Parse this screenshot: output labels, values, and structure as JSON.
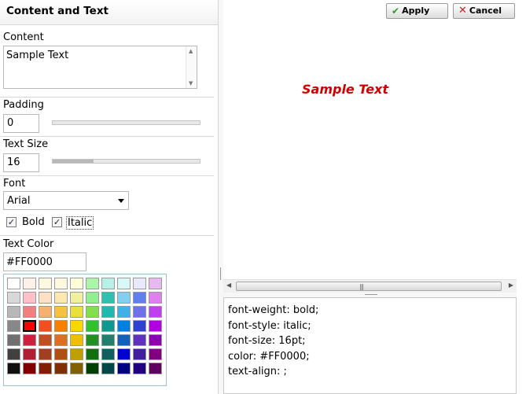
{
  "panel": {
    "title": "Content and Text"
  },
  "content": {
    "label": "Content",
    "value": "Sample Text"
  },
  "padding": {
    "label": "Padding",
    "value": "0",
    "slider_fraction": 0.0
  },
  "text_size": {
    "label": "Text Size",
    "value": "16",
    "slider_fraction": 0.28
  },
  "font": {
    "label": "Font",
    "selected": "Arial"
  },
  "bold": {
    "label": "Bold",
    "checked": true
  },
  "italic": {
    "label": "Italic",
    "checked": true
  },
  "text_color": {
    "label": "Text Color",
    "value": "#FF0000"
  },
  "palette": {
    "selected": "#FF0000",
    "rows": [
      [
        "#FFFFFF",
        "#FFF0E8",
        "#FFF8E0",
        "#FFF8E0",
        "#FFFFD8",
        "#A8F8A8",
        "#B8F0E8",
        "#D8F8F8",
        "#E8E8FF",
        "#E8B8F0"
      ],
      [
        "#D8D8D8",
        "#FFC0C8",
        "#FFE0C0",
        "#FFE8B0",
        "#F0F0A0",
        "#90F090",
        "#30C0B0",
        "#80D0F0",
        "#6080F0",
        "#E080F0"
      ],
      [
        "#B8B8B8",
        "#F08080",
        "#F8B070",
        "#F8C040",
        "#E8E040",
        "#80E050",
        "#20B8B0",
        "#40B0E8",
        "#7070E8",
        "#C040F0"
      ],
      [
        "#888888",
        "#FF0000",
        "#F05020",
        "#F88000",
        "#F8D800",
        "#30C030",
        "#109890",
        "#0080E0",
        "#3040D0",
        "#B000E0"
      ],
      [
        "#707070",
        "#D02040",
        "#C05020",
        "#E07020",
        "#F0C000",
        "#209020",
        "#208070",
        "#1060C0",
        "#6030C0",
        "#9000B0"
      ],
      [
        "#404040",
        "#B02030",
        "#A04020",
        "#B05010",
        "#C0A000",
        "#107010",
        "#106060",
        "#0000D0",
        "#4020A0",
        "#800080"
      ],
      [
        "#101010",
        "#800000",
        "#802000",
        "#803000",
        "#806000",
        "#004000",
        "#004848",
        "#000080",
        "#200080",
        "#600060"
      ]
    ]
  },
  "buttons": {
    "apply": "Apply",
    "cancel": "Cancel"
  },
  "preview": {
    "text": "Sample Text",
    "color": "#D40000"
  },
  "css_output": [
    "font-weight: bold;",
    "font-style: italic;",
    "font-size: 16pt;",
    "color: #FF0000;",
    "text-align: ;"
  ],
  "icons": {
    "apply": "check-icon",
    "cancel": "x-icon",
    "font_dropdown": "chevron-down-icon"
  }
}
